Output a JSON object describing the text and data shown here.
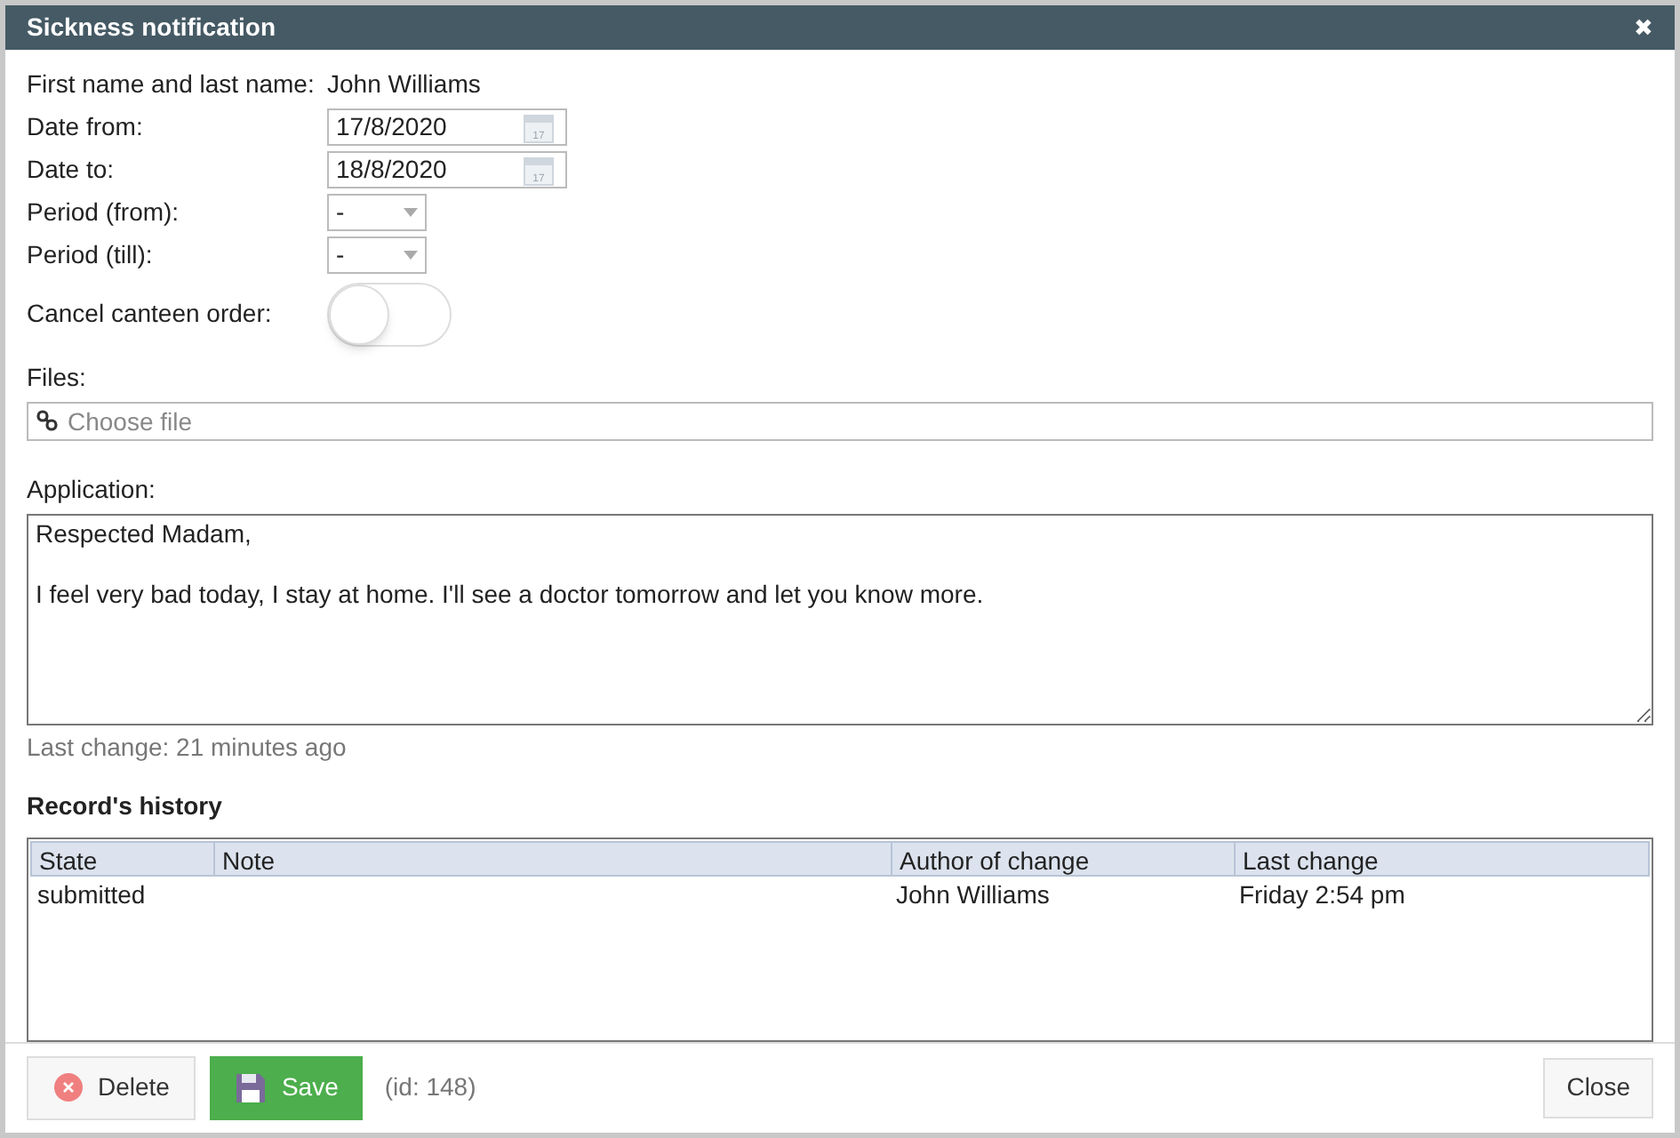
{
  "window": {
    "title": "Sickness notification",
    "close": "✖"
  },
  "form": {
    "name_label": "First name and last name:",
    "name_value": "John Williams",
    "date_from": {
      "label": "Date from:",
      "value": "17/8/2020",
      "calendar_day": "17"
    },
    "date_to": {
      "label": "Date to:",
      "value": "18/8/2020",
      "calendar_day": "17"
    },
    "period_from": {
      "label": "Period (from):",
      "value": "-"
    },
    "period_till": {
      "label": "Period (till):",
      "value": "-"
    },
    "cancel_canteen": {
      "label": "Cancel canteen order:",
      "checked": false
    },
    "files": {
      "label": "Files:",
      "placeholder": "Choose file"
    },
    "application": {
      "label": "Application:",
      "value": "Respected Madam,\n\nI feel very bad today, I stay at home. I'll see a doctor tomorrow and let you know more."
    },
    "last_change": "Last change: 21 minutes ago"
  },
  "history": {
    "title": "Record's history",
    "columns": [
      "State",
      "Note",
      "Author of change",
      "Last change"
    ],
    "rows": [
      [
        "submitted",
        "",
        "John Williams",
        "Friday 2:54 pm"
      ]
    ]
  },
  "footer": {
    "delete": "Delete",
    "save": "Save",
    "id": "(id: 148)",
    "close": "Close"
  }
}
